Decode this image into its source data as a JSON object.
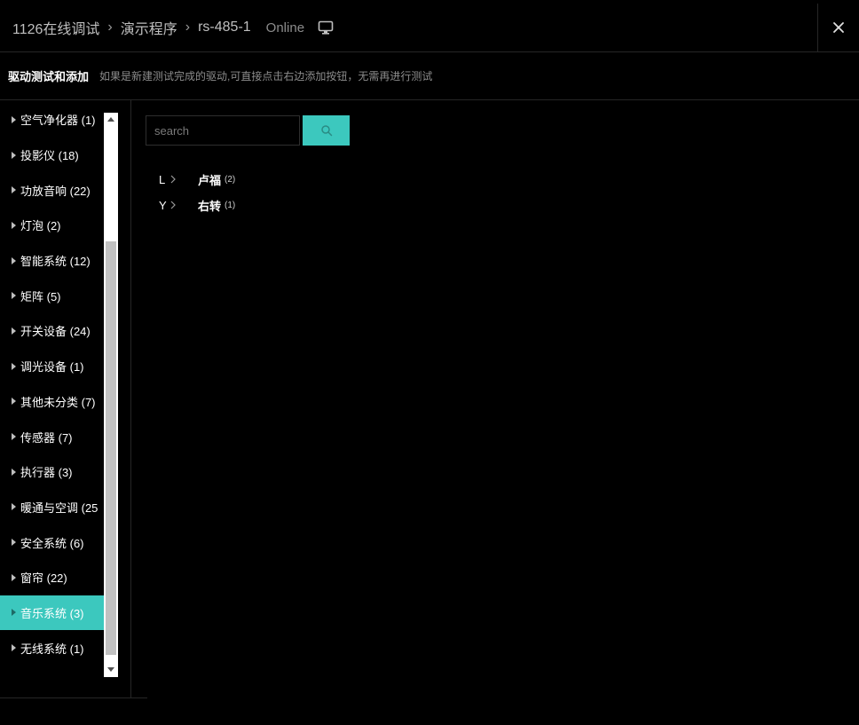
{
  "header": {
    "breadcrumb": [
      "1126在线调试",
      "演示程序",
      "rs-485-1"
    ],
    "status": "Online",
    "monitor_icon": "monitor-icon",
    "close_icon": "close-icon"
  },
  "subheader": {
    "title": "驱动测试和添加",
    "description": "如果是新建测试完成的驱动,可直接点击右边添加按钮，无需再进行测试"
  },
  "sidebar": {
    "categories": [
      {
        "label": "空气净化器 (1)"
      },
      {
        "label": "投影仪 (18)"
      },
      {
        "label": "功放音响 (22)"
      },
      {
        "label": "灯泡 (2)"
      },
      {
        "label": "智能系统 (12)"
      },
      {
        "label": "矩阵 (5)"
      },
      {
        "label": "开关设备 (24)"
      },
      {
        "label": "调光设备 (1)"
      },
      {
        "label": "其他未分类 (7)"
      },
      {
        "label": "传感器 (7)"
      },
      {
        "label": "执行器 (3)"
      },
      {
        "label": "暖通与空调 (25"
      },
      {
        "label": "安全系统 (6)"
      },
      {
        "label": "窗帘 (22)"
      },
      {
        "label": "音乐系统 (3)"
      },
      {
        "label": "无线系统 (1)"
      }
    ],
    "active_index": 14
  },
  "search": {
    "placeholder": "search",
    "value": ""
  },
  "brands": [
    {
      "letter": "L",
      "name": "卢福",
      "count": "(2)"
    },
    {
      "letter": "Y",
      "name": "右转",
      "count": "(1)"
    }
  ],
  "colors": {
    "accent": "#3cc8be",
    "background": "#000000",
    "divider": "#262626"
  }
}
